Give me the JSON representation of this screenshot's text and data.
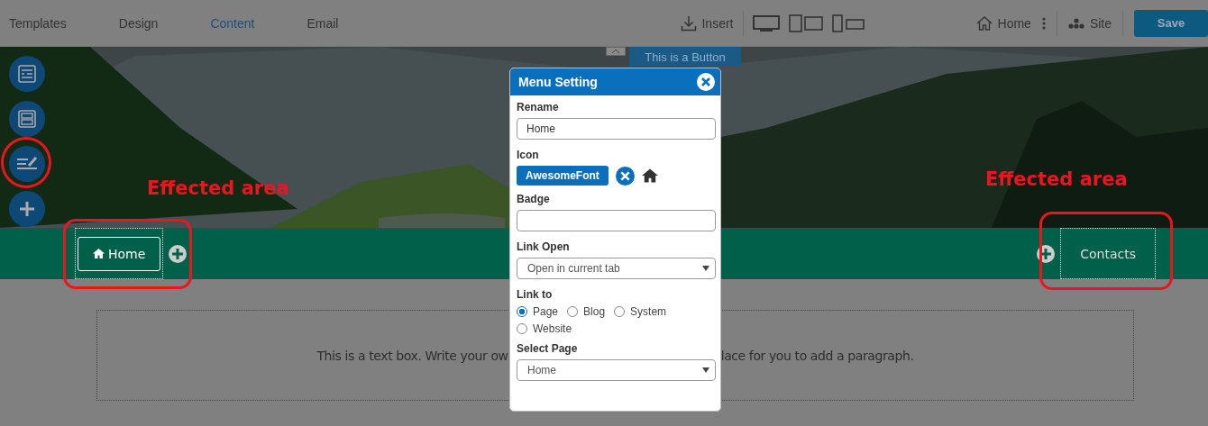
{
  "top_tabs": [
    {
      "label": "Templates",
      "selected": false
    },
    {
      "label": "Design",
      "selected": false
    },
    {
      "label": "Content",
      "selected": true
    },
    {
      "label": "Email",
      "selected": false
    }
  ],
  "insert": {
    "label": "Insert"
  },
  "page_menu": {
    "label": "Home"
  },
  "site": {
    "label": "Site"
  },
  "save_button": {
    "label": "Save"
  },
  "hero_button": {
    "label": "This is a Button"
  },
  "side_tools": [
    {
      "kind": "form",
      "circled": false
    },
    {
      "kind": "layout",
      "circled": false
    },
    {
      "kind": "edit",
      "circled": true
    },
    {
      "kind": "add",
      "circled": false
    }
  ],
  "nav_items": [
    {
      "label": "Home",
      "has_icon": true,
      "selected": true
    },
    {
      "label": "Contacts",
      "has_icon": false,
      "selected": false
    }
  ],
  "annotations": [
    {
      "label": "Effected area"
    },
    {
      "label": "Effected area"
    }
  ],
  "text_box": {
    "left": "This is a text box. Write your ow",
    "right": "lace for you to add a paragraph."
  },
  "dialog": {
    "title": "Menu Setting",
    "rename_label": "Rename",
    "rename_value": "Home",
    "icon_label": "Icon",
    "icon_button": "AwesomeFont",
    "badge_label": "Badge",
    "link_open_label": "Link Open",
    "link_open_value": "Open in current tab",
    "link_to_label": "Link to",
    "link_to_options": [
      {
        "label": "Page",
        "selected": true
      },
      {
        "label": "Blog",
        "selected": false
      },
      {
        "label": "System",
        "selected": false
      },
      {
        "label": "Website",
        "selected": false
      }
    ],
    "select_page_label": "Select Page",
    "select_page_value": "Home"
  }
}
